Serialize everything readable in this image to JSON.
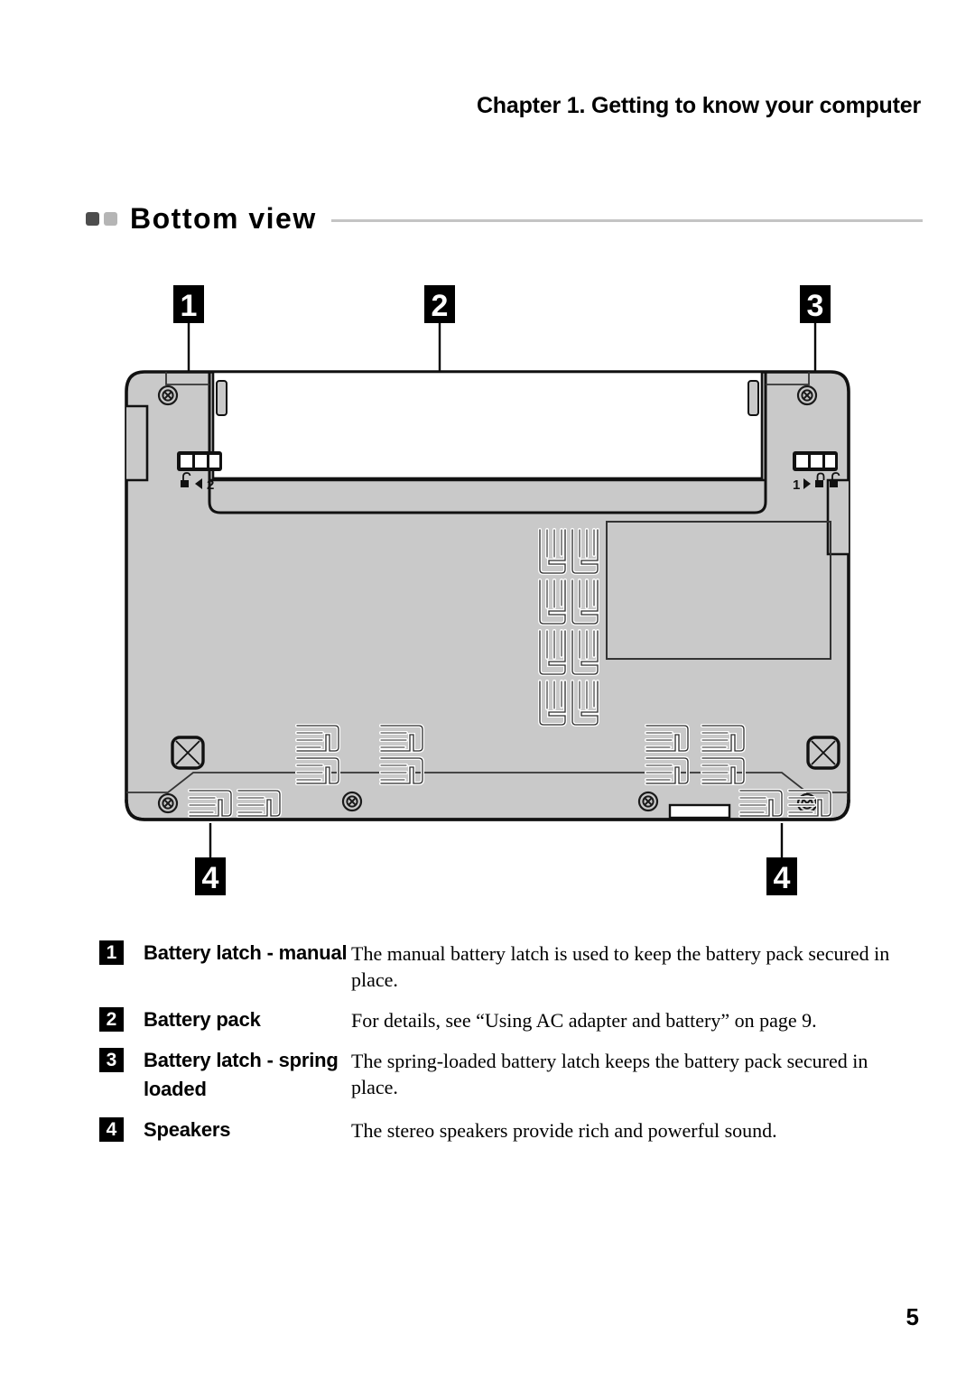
{
  "header": {
    "chapter": "Chapter 1. Getting to know your computer"
  },
  "section": {
    "title": "Bottom view",
    "bullet_dark_color": "#4d4d4d",
    "bullet_light_color": "#b5b5b5",
    "rule_color": "#c4c4c4"
  },
  "figure": {
    "alt": "Bottom view of laptop computer chassis",
    "body_color": "#c9c9c9",
    "battery_color": "#ffffff",
    "line_color": "#000000",
    "callouts": [
      {
        "number": "1",
        "position": "top-left"
      },
      {
        "number": "2",
        "position": "top-center"
      },
      {
        "number": "3",
        "position": "top-right"
      },
      {
        "number": "4",
        "position": "bottom-left"
      },
      {
        "number": "4",
        "position": "bottom-right"
      }
    ],
    "latch_left": {
      "name": "manual-battery-latch",
      "icon": "unlock-icon",
      "arrow": "◀",
      "marking": "2"
    },
    "latch_right": {
      "name": "spring-loaded-battery-latch",
      "marking": "1",
      "arrow": "▶",
      "icon_locked": "lock-closed-icon",
      "icon_unlocked": "lock-open-icon"
    }
  },
  "legend": {
    "rows": [
      {
        "number": "1",
        "label": "Battery latch - manual",
        "description": "The manual battery latch is used to keep the battery pack secured in place."
      },
      {
        "number": "2",
        "label": "Battery pack",
        "description": "For details, see “Using AC adapter and battery” on page 9."
      },
      {
        "number": "3",
        "label": "Battery latch - spring loaded",
        "description": "The spring-loaded battery latch keeps the battery pack secured in place."
      },
      {
        "number": "4",
        "label": "Speakers",
        "description": "The stereo speakers provide rich and powerful sound."
      }
    ]
  },
  "folio": {
    "page_number": "5"
  }
}
